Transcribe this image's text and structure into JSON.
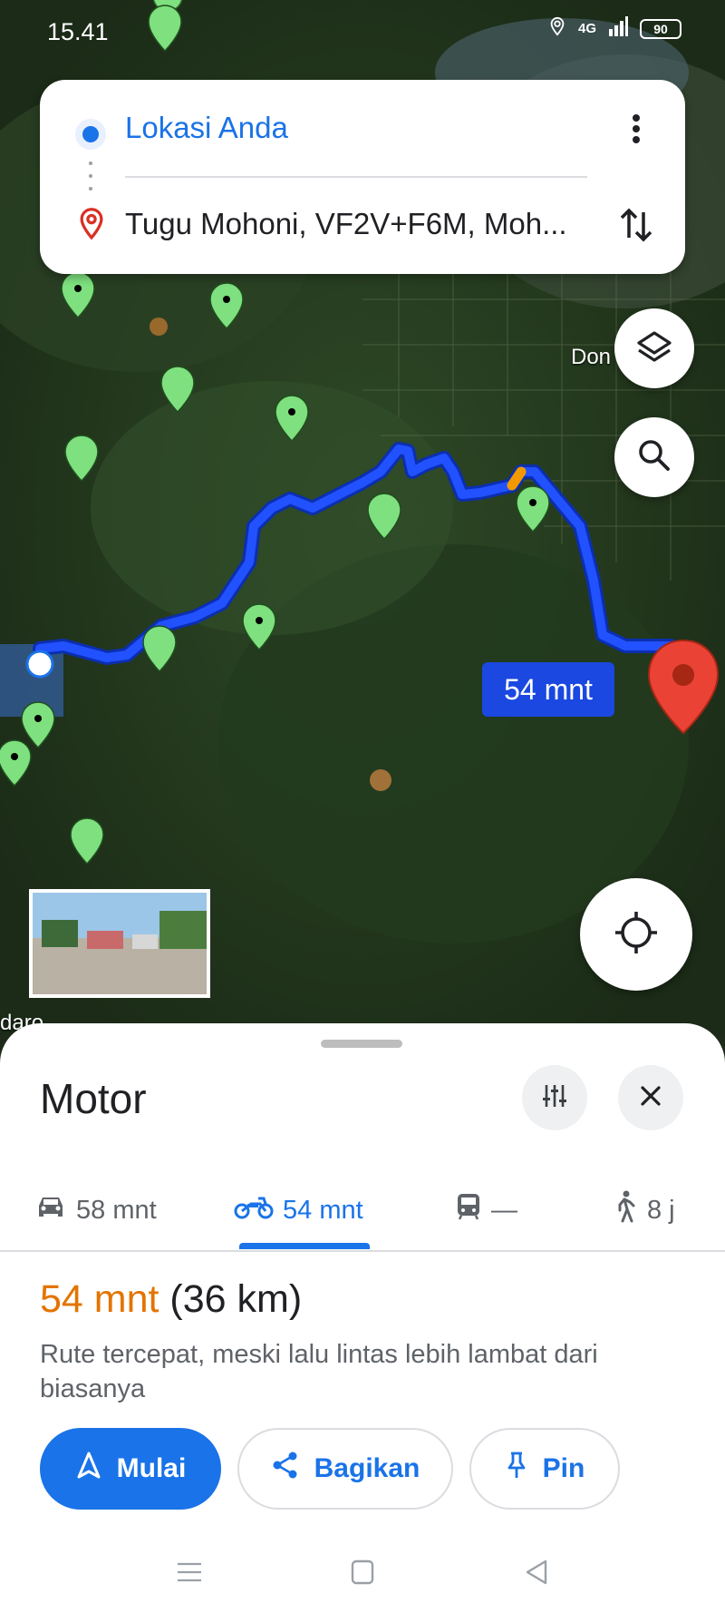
{
  "status_bar": {
    "time": "15.41",
    "network": "4G",
    "battery": "90"
  },
  "search": {
    "origin": "Lokasi Anda",
    "destination": "Tugu Mohoni, VF2V+F6M, Moh..."
  },
  "map": {
    "route_duration_label": "54 mnt",
    "labels": {
      "top_right": "Don",
      "bottom_left": "daro"
    },
    "colors": {
      "route": "#1a48e0",
      "traffic": "#f29900",
      "dest_pin": "#ea4335",
      "poi_pin": "#7ee07e"
    }
  },
  "sheet": {
    "title": "Motor",
    "tabs": [
      {
        "icon": "car-icon",
        "label": "58 mnt",
        "active": false
      },
      {
        "icon": "motorcycle-icon",
        "label": "54 mnt",
        "active": true
      },
      {
        "icon": "transit-icon",
        "label": "—",
        "active": false
      },
      {
        "icon": "walk-icon",
        "label": "8 j",
        "active": false
      }
    ],
    "summary": {
      "eta": "54 mnt",
      "distance": " (36 km)"
    },
    "description": "Rute tercepat, meski lalu lintas lebih lambat dari biasanya",
    "actions": {
      "start": "Mulai",
      "share": "Bagikan",
      "pin": "Pin"
    },
    "accent": "#1a73e8"
  }
}
